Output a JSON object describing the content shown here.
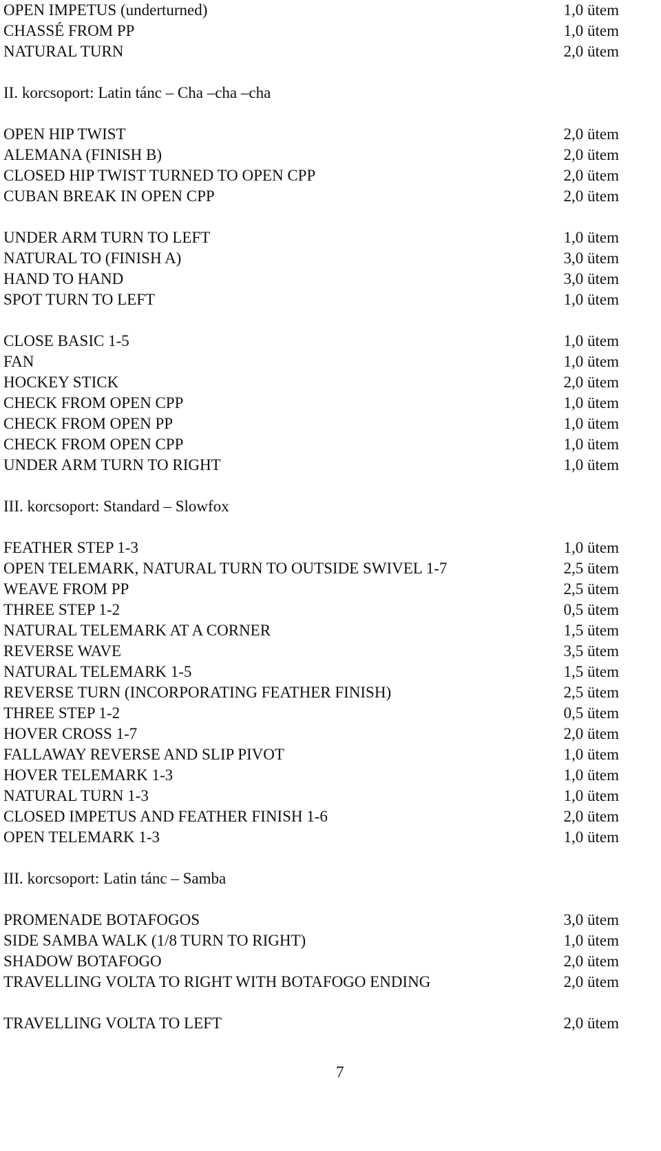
{
  "page_number": "7",
  "blocks": [
    {
      "type": "row",
      "name": "OPEN IMPETUS (underturned)",
      "beats": "1,0 ütem",
      "line": 0
    },
    {
      "type": "row",
      "name": "CHASSÉ FROM PP",
      "beats": "1,0 ütem",
      "line": 1
    },
    {
      "type": "row",
      "name": "NATURAL TURN",
      "beats": "2,0 ütem",
      "line": 2
    },
    {
      "type": "heading",
      "text": "II. korcsoport: Latin tánc – Cha –cha –cha",
      "line": 4
    },
    {
      "type": "row",
      "name": "OPEN HIP TWIST",
      "beats": "2,0 ütem",
      "line": 6
    },
    {
      "type": "row",
      "name": "ALEMANA (FINISH B)",
      "beats": "2,0 ütem",
      "line": 7
    },
    {
      "type": "row",
      "name": "CLOSED HIP TWIST TURNED TO OPEN CPP",
      "beats": "2,0 ütem",
      "line": 8
    },
    {
      "type": "row",
      "name": "CUBAN BREAK IN OPEN CPP",
      "beats": "2,0 ütem",
      "line": 9
    },
    {
      "type": "row",
      "name": "UNDER ARM TURN TO LEFT",
      "beats": "1,0 ütem",
      "line": 11
    },
    {
      "type": "row",
      "name": "NATURAL TO (FINISH A)",
      "beats": "3,0 ütem",
      "line": 12
    },
    {
      "type": "row",
      "name": "HAND TO HAND",
      "beats": "3,0 ütem",
      "line": 13
    },
    {
      "type": "row",
      "name": "SPOT TURN TO LEFT",
      "beats": "1,0 ütem",
      "line": 14
    },
    {
      "type": "row",
      "name": "CLOSE BASIC 1-5",
      "beats": "1,0 ütem",
      "line": 16
    },
    {
      "type": "row",
      "name": "FAN",
      "beats": "1,0 ütem",
      "line": 17
    },
    {
      "type": "row",
      "name": "HOCKEY STICK",
      "beats": "2,0 ütem",
      "line": 18
    },
    {
      "type": "row",
      "name": "CHECK FROM OPEN CPP",
      "beats": "1,0 ütem",
      "line": 19
    },
    {
      "type": "row",
      "name": "CHECK FROM OPEN PP",
      "beats": "1,0 ütem",
      "line": 20
    },
    {
      "type": "row",
      "name": "CHECK FROM OPEN CPP",
      "beats": "1,0 ütem",
      "line": 21
    },
    {
      "type": "row",
      "name": "UNDER ARM TURN TO RIGHT",
      "beats": "1,0 ütem",
      "line": 22
    },
    {
      "type": "heading",
      "text": "III. korcsoport: Standard – Slowfox",
      "line": 24
    },
    {
      "type": "row",
      "name": "FEATHER STEP 1-3",
      "beats": "1,0 ütem",
      "line": 26
    },
    {
      "type": "row",
      "name": "OPEN TELEMARK, NATURAL TURN TO OUTSIDE SWIVEL 1-7",
      "beats": "2,5 ütem",
      "line": 27
    },
    {
      "type": "row",
      "name": "WEAVE FROM PP",
      "beats": "2,5 ütem",
      "line": 28
    },
    {
      "type": "row",
      "name": "THREE STEP 1-2",
      "beats": "0,5 ütem",
      "line": 29
    },
    {
      "type": "row",
      "name": "NATURAL TELEMARK AT A CORNER",
      "beats": "1,5 ütem",
      "line": 30
    },
    {
      "type": "row",
      "name": "REVERSE WAVE",
      "beats": "3,5 ütem",
      "line": 31
    },
    {
      "type": "row",
      "name": "NATURAL TELEMARK 1-5",
      "beats": "1,5 ütem",
      "line": 32
    },
    {
      "type": "row",
      "name": "REVERSE TURN (INCORPORATING FEATHER FINISH)",
      "beats": "2,5 ütem",
      "line": 33
    },
    {
      "type": "row",
      "name": "THREE STEP 1-2",
      "beats": "0,5 ütem",
      "line": 34
    },
    {
      "type": "row",
      "name": "HOVER CROSS 1-7",
      "beats": "2,0 ütem",
      "line": 35
    },
    {
      "type": "row",
      "name": "FALLAWAY REVERSE AND SLIP PIVOT",
      "beats": "1,0 ütem",
      "line": 36
    },
    {
      "type": "row",
      "name": "HOVER TELEMARK 1-3",
      "beats": "1,0 ütem",
      "line": 37
    },
    {
      "type": "row",
      "name": "NATURAL TURN 1-3",
      "beats": "1,0 ütem",
      "line": 38
    },
    {
      "type": "row",
      "name": "CLOSED IMPETUS AND FEATHER FINISH 1-6",
      "beats": "2,0 ütem",
      "line": 39
    },
    {
      "type": "row",
      "name": "OPEN TELEMARK 1-3",
      "beats": "1,0 ütem",
      "line": 40
    },
    {
      "type": "heading",
      "text": "III. korcsoport: Latin tánc – Samba",
      "line": 42
    },
    {
      "type": "row",
      "name": "PROMENADE BOTAFOGOS",
      "beats": "3,0 ütem",
      "line": 44
    },
    {
      "type": "row",
      "name": "SIDE SAMBA WALK (1/8 TURN TO RIGHT)",
      "beats": "1,0 ütem",
      "line": 45
    },
    {
      "type": "row",
      "name": "SHADOW BOTAFOGO",
      "beats": "2,0 ütem",
      "line": 46
    },
    {
      "type": "row",
      "name": "TRAVELLING VOLTA TO RIGHT WITH BOTAFOGO ENDING",
      "beats": "2,0 ütem",
      "line": 47
    },
    {
      "type": "row",
      "name": "TRAVELLING VOLTA TO LEFT",
      "beats": "2,0 ütem",
      "line": 49
    }
  ]
}
